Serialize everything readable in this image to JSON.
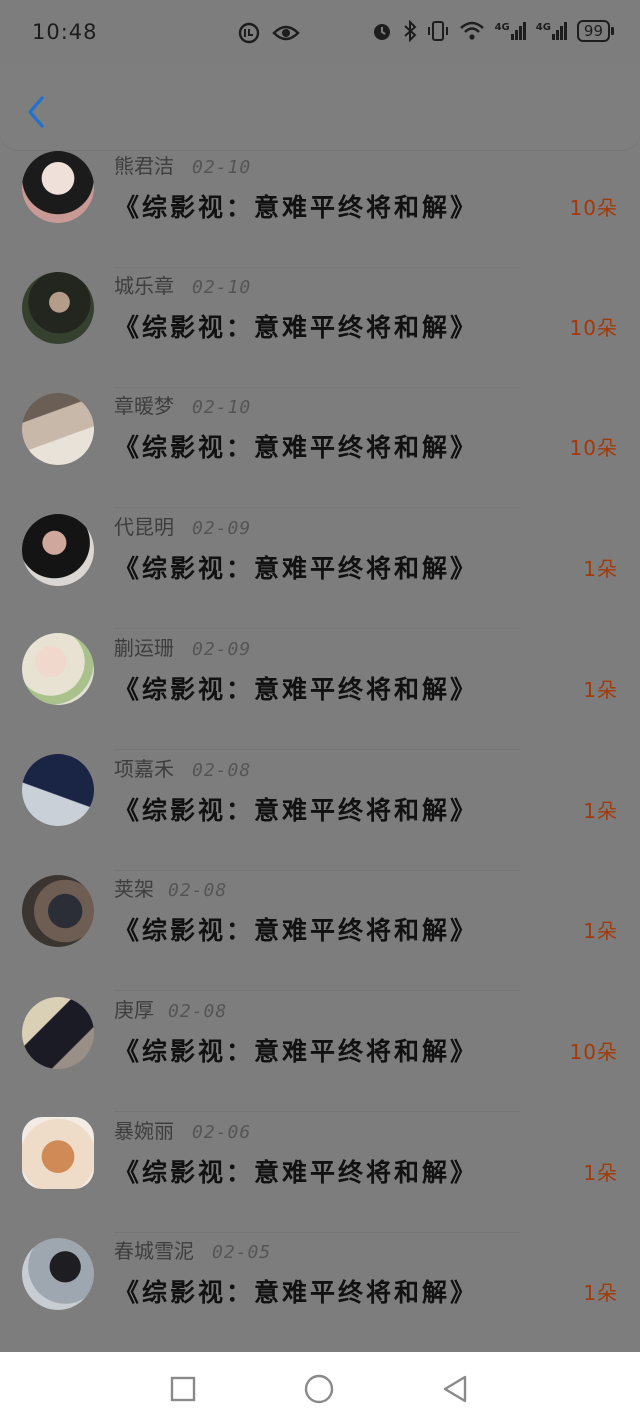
{
  "status_bar": {
    "time": "10:48",
    "battery": "99",
    "network_1": "4G",
    "network_2": "4G"
  },
  "header": {
    "back_icon": "chevron-left-icon",
    "accent_color": "#1e73d2"
  },
  "items": [
    {
      "name": "熊君洁",
      "date": "02-10",
      "title": "《综影视：意难平终将和解》",
      "count": "10朵"
    },
    {
      "name": "城乐章",
      "date": "02-10",
      "title": "《综影视：意难平终将和解》",
      "count": "10朵"
    },
    {
      "name": "章暖梦",
      "date": "02-10",
      "title": "《综影视：意难平终将和解》",
      "count": "10朵"
    },
    {
      "name": "代昆明",
      "date": "02-09",
      "title": "《综影视：意难平终将和解》",
      "count": "1朵"
    },
    {
      "name": "蒯运珊",
      "date": "02-09",
      "title": "《综影视：意难平终将和解》",
      "count": "1朵"
    },
    {
      "name": "项嘉禾",
      "date": "02-08",
      "title": "《综影视：意难平终将和解》",
      "count": "1朵"
    },
    {
      "name": "荚架",
      "date": "02-08",
      "title": "《综影视：意难平终将和解》",
      "count": "1朵"
    },
    {
      "name": "庚厚",
      "date": "02-08",
      "title": "《综影视：意难平终将和解》",
      "count": "10朵"
    },
    {
      "name": "暴婉丽",
      "date": "02-06",
      "title": "《综影视：意难平终将和解》",
      "count": "1朵"
    },
    {
      "name": "春城雪泥",
      "date": "02-05",
      "title": "《综影视：意难平终将和解》",
      "count": "1朵"
    }
  ],
  "colors": {
    "count": "#a33a08",
    "overlay_bg": "#7d7d7d"
  },
  "nav": {
    "recent_icon": "square-icon",
    "home_icon": "circle-icon",
    "back_icon": "triangle-back-icon"
  }
}
